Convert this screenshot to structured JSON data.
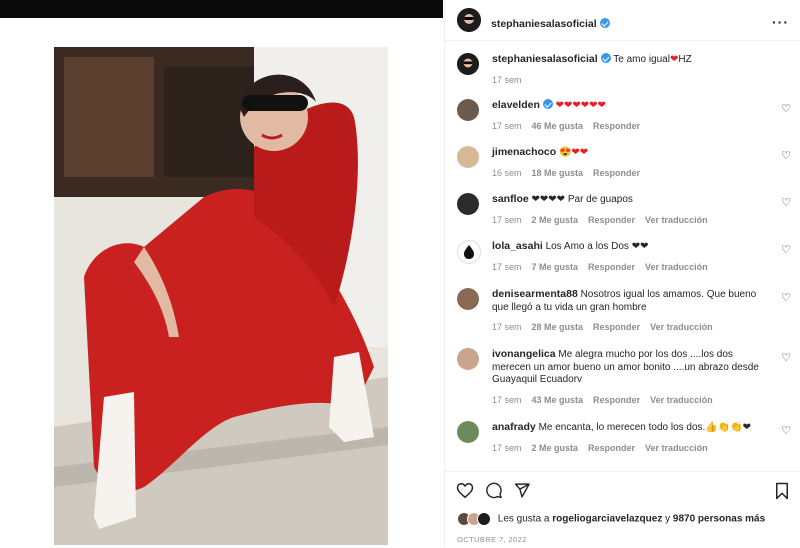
{
  "post": {
    "username": "stephaniesalasoficial",
    "caption_user": "stephaniesalasoficial",
    "caption_text": "Te amo igual",
    "caption_heart": "❤",
    "caption_tail": "HZ",
    "caption_time": "17 sem"
  },
  "ui": {
    "like_label": "Me gusta",
    "reply_label": "Responder",
    "translate_label": "Ver traducción"
  },
  "comments": [
    {
      "user": "elavelden",
      "verified": true,
      "text": "❤❤❤❤❤❤",
      "time": "17 sem",
      "likes": "46 Me gusta",
      "reply": "Responder",
      "translate": ""
    },
    {
      "user": "jimenachoco",
      "verified": false,
      "text": "😍❤❤",
      "time": "16 sem",
      "likes": "18 Me gusta",
      "reply": "Responder",
      "translate": ""
    },
    {
      "user": "sanfloe",
      "verified": false,
      "text": "❤❤❤❤ Par de guapos",
      "time": "17 sem",
      "likes": "2 Me gusta",
      "reply": "Responder",
      "translate": "Ver traducción"
    },
    {
      "user": "lola_asahi",
      "verified": false,
      "text": "Los Amo a los Dos ❤❤",
      "time": "17 sem",
      "likes": "7 Me gusta",
      "reply": "Responder",
      "translate": "Ver traducción"
    },
    {
      "user": "denisearmenta88",
      "verified": false,
      "text": "Nosotros igual los amamos. Que bueno que llegó a tu vida un gran hombre",
      "time": "17 sem",
      "likes": "28 Me gusta",
      "reply": "Responder",
      "translate": "Ver traducción"
    },
    {
      "user": "ivonangelica",
      "verified": false,
      "text": "Me alegra mucho por los dos ....los dos merecen un amor bueno un amor bonito ....un abrazo desde Guayaquil Ecuadorv",
      "time": "17 sem",
      "likes": "43 Me gusta",
      "reply": "Responder",
      "translate": "Ver traducción"
    },
    {
      "user": "anafrady",
      "verified": false,
      "text": "Me encanta, lo merecen todo los dos.👍👏👏❤",
      "time": "17 sem",
      "likes": "2 Me gusta",
      "reply": "Responder",
      "translate": "Ver traducción"
    }
  ],
  "likes_summary": {
    "prefix": "Les gusta a",
    "user": "rogeliogarciavelazquez",
    "mid": "y",
    "count": "9870 personas más"
  },
  "date": "OCTUBRE 7, 2022",
  "colors": {
    "accent": "#3897f0",
    "heart": "#ed1c24",
    "dress": "#c8211f",
    "muted": "#8e8e8e"
  },
  "icons": [
    "more-icon",
    "heart-outline-icon",
    "comment-icon",
    "share-icon",
    "bookmark-icon",
    "verified-icon"
  ]
}
